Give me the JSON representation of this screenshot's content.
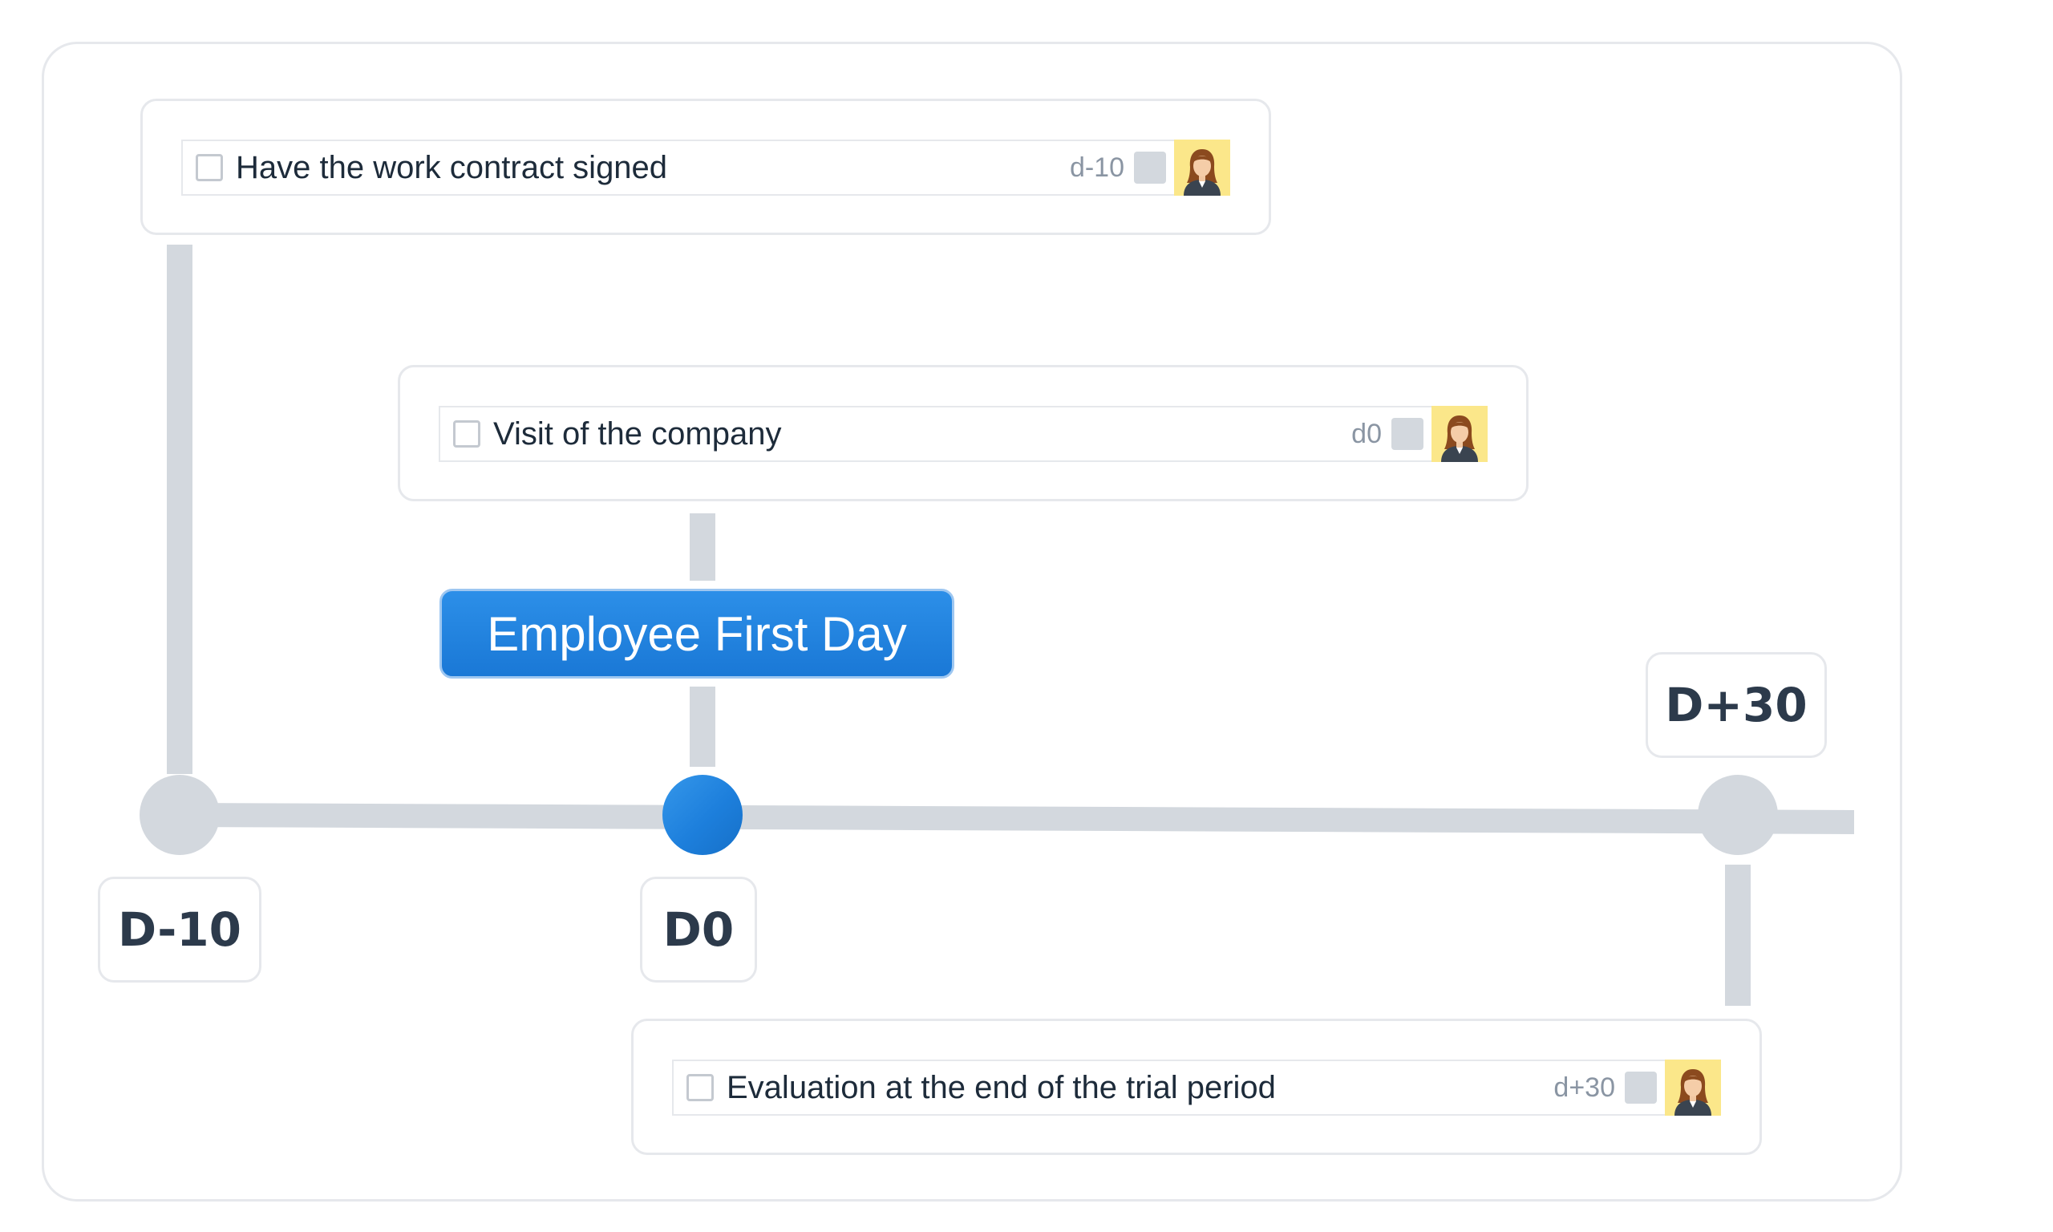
{
  "timeline": {
    "milestone_label": "Employee First Day",
    "axis_labels": [
      "D-10",
      "D0",
      "D+30"
    ]
  },
  "tasks": [
    {
      "label": "Have the work contract signed",
      "due": "d-10",
      "avatar_icon": "female-employee-avatar-icon"
    },
    {
      "label": "Visit of the company",
      "due": "d0",
      "avatar_icon": "female-employee-avatar-icon"
    },
    {
      "label": "Evaluation at the end of the trial period",
      "due": "d+30",
      "avatar_icon": "female-employee-avatar-icon"
    }
  ],
  "colors": {
    "accent": "#1f80dc",
    "track": "#d3d8de",
    "avatar_bg": "#fbe78a",
    "text": "#1d2b3a",
    "muted_text": "#8a95a3"
  }
}
